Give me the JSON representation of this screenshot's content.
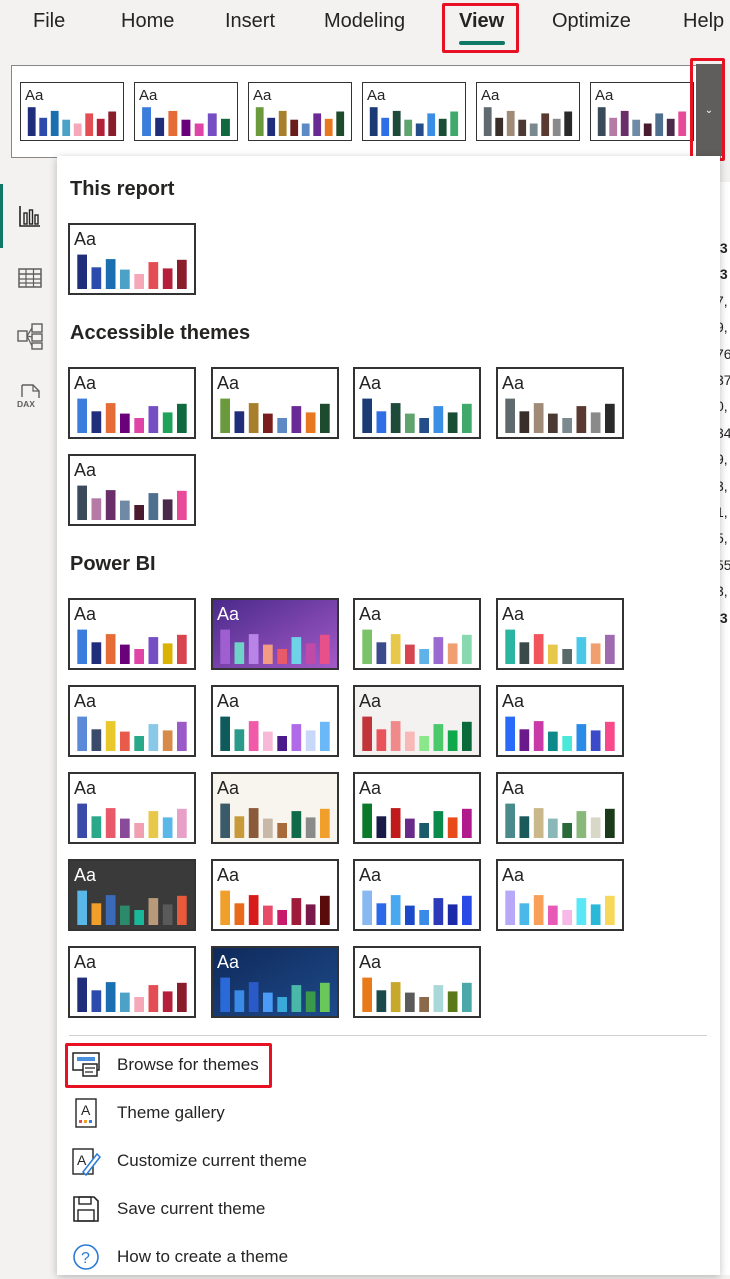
{
  "menu": {
    "items": [
      "File",
      "Home",
      "Insert",
      "Modeling",
      "View",
      "Optimize",
      "Help"
    ],
    "active": "View"
  },
  "aa_label": "Aa",
  "ribbon_gallery": [
    {
      "bg": "#ffffff",
      "text": "#252423",
      "bars": [
        "#1f2d7b",
        "#2c4cad",
        "#1a6fb0",
        "#4ba2c6",
        "#f6a7b8",
        "#e34d54",
        "#b51f3a",
        "#8a1d2c"
      ]
    },
    {
      "bg": "#ffffff",
      "text": "#252423",
      "bars": [
        "#3b7ddd",
        "#1f2d7b",
        "#e66c37",
        "#6b007b",
        "#e044a7",
        "#744ec2",
        "#0f6b3f"
      ]
    },
    {
      "bg": "#ffffff",
      "text": "#252423",
      "bars": [
        "#6a9a3b",
        "#1f2d7b",
        "#a87f2c",
        "#6b1d1d",
        "#5d8ac4",
        "#6a2a96",
        "#e87722",
        "#1e4a2e"
      ]
    },
    {
      "bg": "#ffffff",
      "text": "#252423",
      "bars": [
        "#1a3b73",
        "#2f6fe5",
        "#1e4a3a",
        "#5fa36e",
        "#254d8a",
        "#3b8ee6",
        "#184d36",
        "#3fa86b"
      ]
    },
    {
      "bg": "#ffffff",
      "text": "#252423",
      "bars": [
        "#5f6a6f",
        "#3a2e2a",
        "#a08a78",
        "#4a3a33",
        "#7a8a8e",
        "#5a3a30",
        "#8a8a8a",
        "#2a2a2a"
      ]
    },
    {
      "bg": "#ffffff",
      "text": "#252423",
      "bars": [
        "#3a4a5a",
        "#b67aa6",
        "#6a2f6a",
        "#6f8aa6",
        "#4a1a2e",
        "#4f6f8f",
        "#4a2a4a",
        "#e84a9a"
      ]
    }
  ],
  "sections": {
    "this_report": "This report",
    "accessible": "Accessible themes",
    "power_bi": "Power BI"
  },
  "this_report_themes": [
    {
      "bg": "#ffffff",
      "text": "#252423",
      "bars": [
        "#1f2d7b",
        "#2c4cad",
        "#1a6fb0",
        "#4ba2c6",
        "#f6a7b8",
        "#e34d54",
        "#b51f3a",
        "#8a1d2c"
      ]
    }
  ],
  "accessible_themes": [
    {
      "bg": "#ffffff",
      "text": "#252423",
      "bars": [
        "#3b7ddd",
        "#1f2d7b",
        "#e66c37",
        "#6b007b",
        "#e044a7",
        "#744ec2",
        "#1fa35a",
        "#0f6b3f"
      ]
    },
    {
      "bg": "#ffffff",
      "text": "#252423",
      "bars": [
        "#6a9a3b",
        "#1f2d7b",
        "#a87f2c",
        "#7a1d1d",
        "#5d8ac4",
        "#6a2a96",
        "#e87722",
        "#1e4a2e"
      ]
    },
    {
      "bg": "#ffffff",
      "text": "#252423",
      "bars": [
        "#1a3b73",
        "#2f6fe5",
        "#1e4a3a",
        "#5fa36e",
        "#254d8a",
        "#3b8ee6",
        "#184d36",
        "#3fa86b"
      ]
    },
    {
      "bg": "#ffffff",
      "text": "#252423",
      "bars": [
        "#5f6a6f",
        "#3a2e2a",
        "#a08a78",
        "#4a3a33",
        "#7a8a8e",
        "#5a3a30",
        "#8a8a8a",
        "#2a2a2a"
      ]
    },
    {
      "bg": "#ffffff",
      "text": "#252423",
      "bars": [
        "#3a4a5a",
        "#b67aa6",
        "#6a2f6a",
        "#6f8aa6",
        "#4a1a2e",
        "#4f6f8f",
        "#4a2a4a",
        "#e84a9a"
      ]
    }
  ],
  "powerbi_themes": [
    {
      "bg": "#ffffff",
      "text": "#252423",
      "bars": [
        "#3b7ddd",
        "#1f2d7b",
        "#e66c37",
        "#6b007b",
        "#e044a7",
        "#744ec2",
        "#d9b300",
        "#d64550"
      ]
    },
    {
      "bg": "#6b3fa0",
      "text": "#ffffff",
      "gradient": [
        "#4a2a8a",
        "#a45ac8"
      ],
      "bars": [
        "#9f5fd0",
        "#6fd3c8",
        "#b884e8",
        "#f39c84",
        "#e85a6a",
        "#6fd3e8",
        "#c04aa8",
        "#e8508a"
      ]
    },
    {
      "bg": "#ffffff",
      "text": "#252423",
      "bars": [
        "#7ac36a",
        "#3b4a8a",
        "#e8c84a",
        "#d64550",
        "#5fb3e8",
        "#9a6ad0",
        "#f0a070",
        "#88d8b0"
      ]
    },
    {
      "bg": "#ffffff",
      "text": "#252423",
      "bars": [
        "#2ab5a0",
        "#3a4a4a",
        "#f2545b",
        "#e8c84a",
        "#5a6a6a",
        "#4ac8e8",
        "#f0a070",
        "#a06ab0"
      ]
    },
    {
      "bg": "#ffffff",
      "text": "#252423",
      "bars": [
        "#5a8ad8",
        "#3a4a6a",
        "#e8c82a",
        "#e85a4a",
        "#2aa88a",
        "#8ac8e8",
        "#d88a4a",
        "#9a5ac8"
      ]
    },
    {
      "bg": "#ffffff",
      "text": "#252423",
      "bars": [
        "#0f5a5a",
        "#2a9a8a",
        "#f05aa8",
        "#f8b8d8",
        "#4a1a8a",
        "#b06ae8",
        "#c8d8f8",
        "#6ab8f8"
      ]
    },
    {
      "bg": "#f3f2f1",
      "text": "#252423",
      "bars": [
        "#c0343a",
        "#e8545a",
        "#f08a8a",
        "#f8b8b8",
        "#8ae88a",
        "#4ac86a",
        "#0fa84a",
        "#0a6a3a"
      ]
    },
    {
      "bg": "#ffffff",
      "text": "#252423",
      "bars": [
        "#2a6af8",
        "#6a1a8a",
        "#c83aa8",
        "#0a8a8a",
        "#4ae8d8",
        "#2a8ae8",
        "#3a4ac8",
        "#f84a8a"
      ]
    },
    {
      "bg": "#ffffff",
      "text": "#252423",
      "bars": [
        "#3a4aa8",
        "#2aa88a",
        "#e85a6a",
        "#8a4a9a",
        "#f0a0b0",
        "#e8c84a",
        "#5ab8e8",
        "#e8a0c8"
      ]
    },
    {
      "bg": "#f8f5ee",
      "text": "#252423",
      "bars": [
        "#3a5a6a",
        "#c89a3a",
        "#8a5a3a",
        "#c8b8a8",
        "#a86a3a",
        "#0f6a4a",
        "#8a8a8a",
        "#f0a02a"
      ]
    },
    {
      "bg": "#ffffff",
      "text": "#252423",
      "bars": [
        "#0a7a2a",
        "#1a1a4a",
        "#c01a1a",
        "#6a2a8a",
        "#1a5a6a",
        "#0a8a4a",
        "#e84a1a",
        "#b01a8a"
      ]
    },
    {
      "bg": "#ffffff",
      "text": "#252423",
      "bars": [
        "#4a8a8a",
        "#1a5a5a",
        "#c8b88a",
        "#8ab8b8",
        "#2a6a3a",
        "#8ab87a",
        "#d8d8c8",
        "#1a3a1a"
      ]
    },
    {
      "bg": "#3a3a3a",
      "text": "#ffffff",
      "bars": [
        "#5ab8e8",
        "#f0a02a",
        "#3a6ab8",
        "#2a8a6a",
        "#1ab89a",
        "#b89a7a",
        "#5a5a5a",
        "#e85a3a"
      ]
    },
    {
      "bg": "#ffffff",
      "text": "#252423",
      "bars": [
        "#f0a02a",
        "#e86a1a",
        "#d81a1a",
        "#e84a6a",
        "#c81a6a",
        "#a01a3a",
        "#7a1a4a",
        "#5a0a0a"
      ]
    },
    {
      "bg": "#ffffff",
      "text": "#252423",
      "bars": [
        "#8ab8f0",
        "#2a6ae8",
        "#4aa8f0",
        "#1a4ac8",
        "#3a8ae8",
        "#2a3ab8",
        "#1a2aa8",
        "#2a4ae8"
      ]
    },
    {
      "bg": "#ffffff",
      "text": "#252423",
      "bars": [
        "#b8a8f8",
        "#4ab8e8",
        "#f8a05a",
        "#e85ab8",
        "#f8b8e8",
        "#5ae8f8",
        "#2ab8d8",
        "#f8d85a"
      ]
    },
    {
      "bg": "#ffffff",
      "text": "#252423",
      "bars": [
        "#1f2d7b",
        "#2c4cad",
        "#1a6fb0",
        "#4ba2c6",
        "#f6a7b8",
        "#e34d54",
        "#b51f3a",
        "#8a1d2c"
      ]
    },
    {
      "bg": "#1a3a7a",
      "text": "#ffffff",
      "gradient": [
        "#0f2a5a",
        "#1e4a8a"
      ],
      "bars": [
        "#2a6ad8",
        "#3a8ae8",
        "#2a5ac8",
        "#4a9af8",
        "#3aa8d8",
        "#4ab8a8",
        "#3a9a4a",
        "#6ac85a"
      ]
    },
    {
      "bg": "#ffffff",
      "text": "#252423",
      "bars": [
        "#e87a1a",
        "#1a4a4a",
        "#c8a82a",
        "#5a5a5a",
        "#8a6a4a",
        "#a8d8d8",
        "#5a7a1a",
        "#4aa8a8"
      ]
    }
  ],
  "actions": [
    {
      "label": "Browse for themes",
      "icon": "browse-themes-icon"
    },
    {
      "label": "Theme gallery",
      "icon": "theme-gallery-icon"
    },
    {
      "label": "Customize current theme",
      "icon": "customize-theme-icon"
    },
    {
      "label": "Save current theme",
      "icon": "save-theme-icon"
    },
    {
      "label": "How to create a theme",
      "icon": "help-icon"
    }
  ],
  "left_nav": [
    {
      "name": "report-view-icon"
    },
    {
      "name": "table-view-icon"
    },
    {
      "name": "model-view-icon"
    },
    {
      "name": "dax-query-view-icon",
      "label": "DAX"
    }
  ],
  "background_cells": [
    ",3",
    ",3",
    "7,",
    "9,",
    "76",
    "37",
    "0,",
    "34",
    "9,",
    "3,",
    "1,",
    "5,",
    "55",
    "3,",
    ",3"
  ]
}
